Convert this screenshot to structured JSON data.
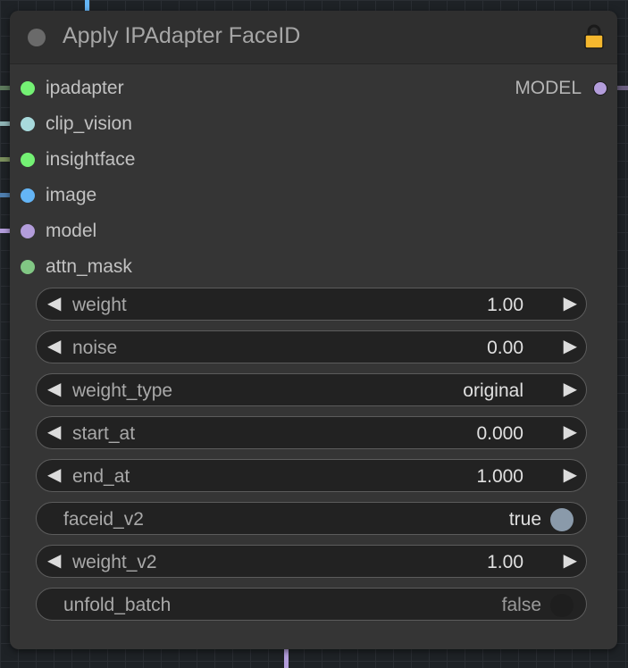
{
  "node": {
    "title": "Apply IPAdapter FaceID",
    "inputs": [
      {
        "label": "ipadapter",
        "color": "#74f174"
      },
      {
        "label": "clip_vision",
        "color": "#a8dadc"
      },
      {
        "label": "insightface",
        "color": "#74f174"
      },
      {
        "label": "image",
        "color": "#64b5f6"
      },
      {
        "label": "model",
        "color": "#b39ddb"
      },
      {
        "label": "attn_mask",
        "color": "#81c784"
      }
    ],
    "output": {
      "label": "MODEL",
      "color": "#b39ddb"
    },
    "widgets": [
      {
        "name": "weight",
        "value": "1.00",
        "kind": "number"
      },
      {
        "name": "noise",
        "value": "0.00",
        "kind": "number"
      },
      {
        "name": "weight_type",
        "value": "original",
        "kind": "combo"
      },
      {
        "name": "start_at",
        "value": "0.000",
        "kind": "number"
      },
      {
        "name": "end_at",
        "value": "1.000",
        "kind": "number"
      },
      {
        "name": "faceid_v2",
        "value": "true",
        "kind": "toggle",
        "on": true
      },
      {
        "name": "weight_v2",
        "value": "1.00",
        "kind": "number"
      },
      {
        "name": "unfold_batch",
        "value": "false",
        "kind": "toggle",
        "on": false
      }
    ]
  },
  "colors": {
    "lock": "#f5b82e",
    "toggle_on": "#8a9aaa",
    "toggle_off": "#1e1e1e"
  },
  "icons": {
    "collapse": "collapse-dot-icon",
    "lock": "lock-icon",
    "left_arrow": "◀",
    "right_arrow": "▶"
  }
}
